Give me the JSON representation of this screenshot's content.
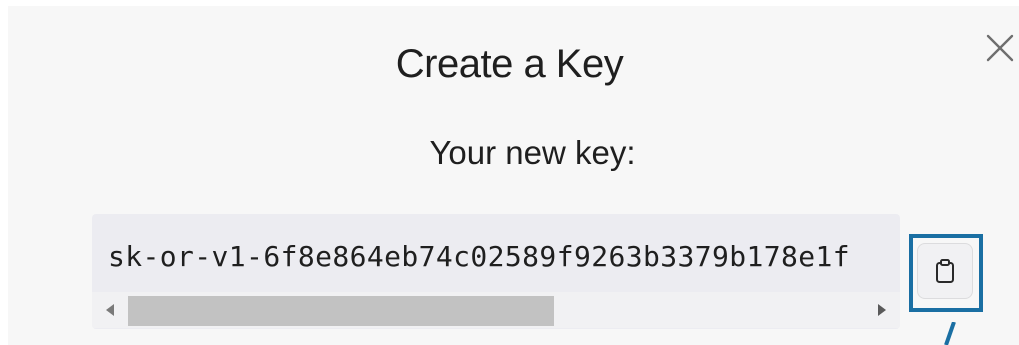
{
  "dialog": {
    "title": "Create a Key",
    "subtitle": "Your new key:",
    "key_value": "sk-or-v1-6f8e864eb74c02589f9263b3379b178e1f",
    "close_icon": "close-icon",
    "copy_icon": "clipboard-icon"
  },
  "colors": {
    "highlight": "#1a6fa3",
    "key_box_bg": "#ececf1",
    "modal_bg": "#f7f7f7"
  }
}
